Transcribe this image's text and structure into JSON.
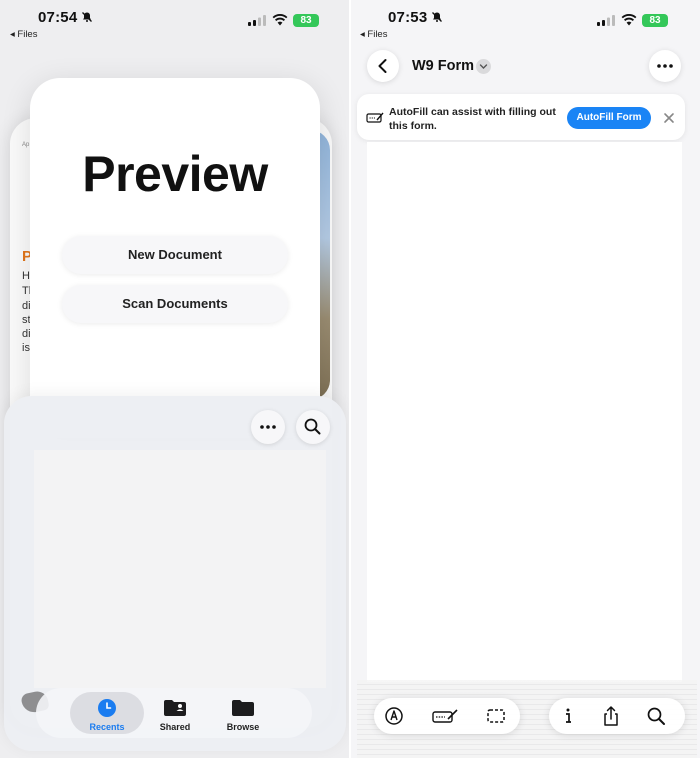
{
  "left_screen": {
    "status": {
      "time": "07:54",
      "back_label": "◂ Files",
      "battery": "83"
    },
    "doc_fragments": {
      "heading_letter": "P",
      "text_letters": [
        "Ap",
        "H",
        "Th",
        "di",
        "st",
        "di",
        "is"
      ]
    },
    "preview": {
      "title": "Preview",
      "new_document": "New Document",
      "scan_documents": "Scan Documents"
    },
    "toolbar_icons": [
      "more-icon",
      "search-icon"
    ],
    "tabs": [
      {
        "label": "Recents",
        "icon": "clock-icon",
        "active": true
      },
      {
        "label": "Shared",
        "icon": "shared-folder-icon",
        "active": false
      },
      {
        "label": "Browse",
        "icon": "folder-icon",
        "active": false
      }
    ]
  },
  "right_screen": {
    "status": {
      "time": "07:53",
      "back_label": "◂ Files",
      "battery": "83"
    },
    "nav": {
      "title": "W9 Form"
    },
    "autofill": {
      "message": "AutoFill can assist with filling out this form.",
      "button": "AutoFill Form"
    },
    "bottom_tools_left": [
      "markup-pen-icon",
      "autofill-signature-icon",
      "select-region-icon"
    ],
    "bottom_tools_right": [
      "info-icon",
      "share-icon",
      "search-icon"
    ]
  },
  "colors": {
    "accent": "#1a84f5",
    "battery": "#34c759",
    "orange_heading": "#e2761b"
  }
}
